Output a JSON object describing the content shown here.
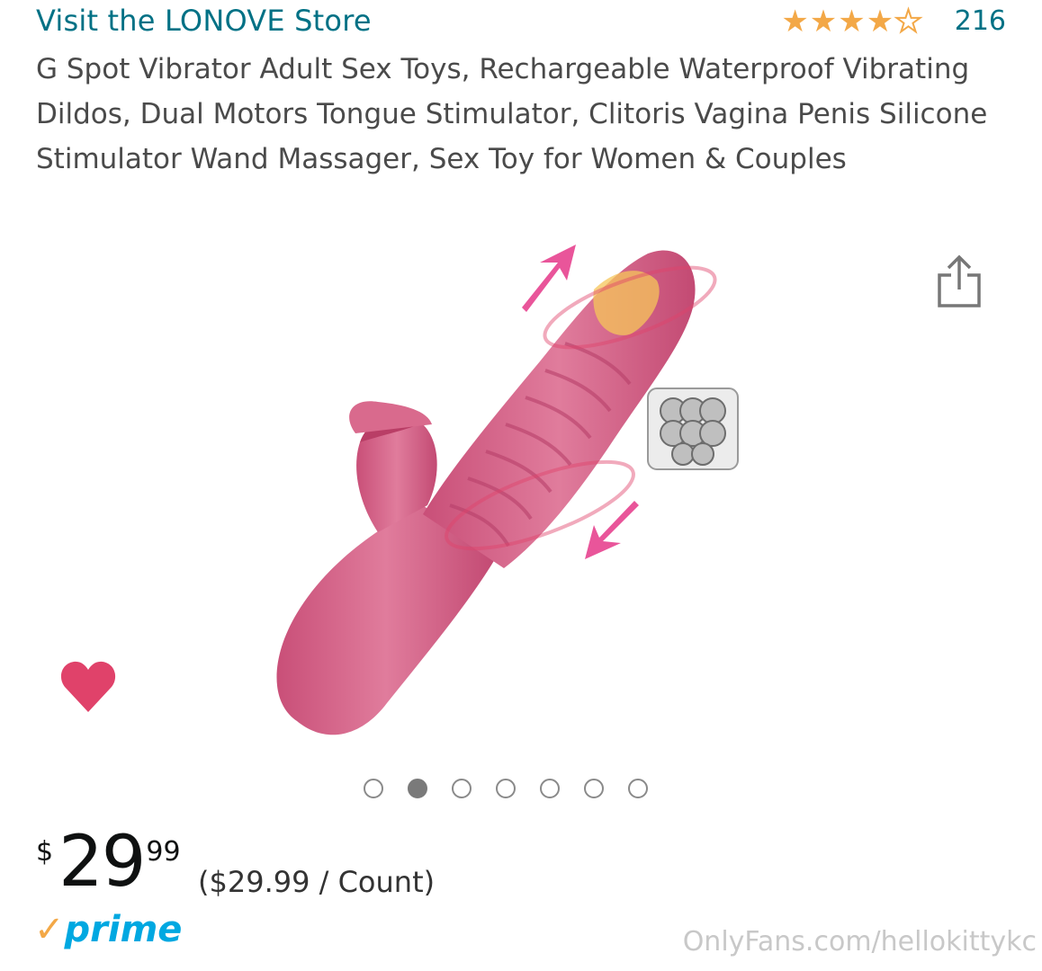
{
  "store": {
    "link_text": "Visit the LONOVE Store"
  },
  "rating": {
    "stars": 4,
    "max_stars": 5,
    "count": "216"
  },
  "product": {
    "title": "G Spot Vibrator Adult Sex Toys, Rechargeable Waterproof Vibrating Dildos, Dual Motors Tongue Stimulator, Clitoris Vagina Penis Silicone Stimulator Wand Massager, Sex Toy for Women & Couples"
  },
  "icons": {
    "share": "share-icon",
    "wishlist": "heart-icon"
  },
  "carousel": {
    "total": 7,
    "active_index": 1
  },
  "price": {
    "symbol": "$",
    "whole": "29",
    "fraction": "99",
    "unit": "($29.99 / Count)"
  },
  "prime": {
    "check": "✓",
    "label": "prime"
  },
  "watermark": "OnlyFans.com/hellokittykc",
  "colors": {
    "link": "#007185",
    "star": "#f3a847",
    "heart": "#e0426a",
    "prime_blue": "#00a8e1",
    "product_pink": "#d9668a"
  }
}
